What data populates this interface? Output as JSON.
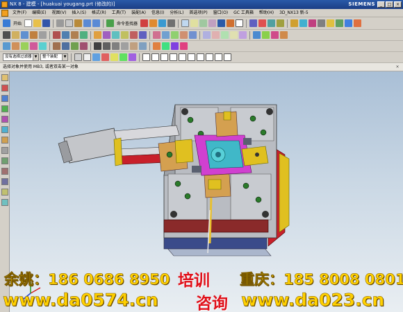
{
  "window": {
    "title": "NX 8 - 建模 - [huakuai yougang.prt (修改的)]",
    "brand": "SIEMENS",
    "controls": [
      "_",
      "□",
      "×"
    ]
  },
  "menu": {
    "items": [
      "文件(F)",
      "编辑(E)",
      "视图(V)",
      "插入(S)",
      "格式(R)",
      "工具(T)",
      "装配(A)",
      "信息(I)",
      "分析(L)",
      "首选项(P)",
      "窗口(O)",
      "GC 工具箱",
      "帮助(H)",
      "3D_NX13 新-5"
    ]
  },
  "toolbar": {
    "start_label": "开始",
    "command_finder_label": "命令查找器",
    "filter_label": "没有选择过滤器",
    "assembly_scope_label": "整个装配"
  },
  "cue": {
    "text": "选择对象并使用 MB3, 或者双击某一对象"
  },
  "watermark": {
    "left_phone": "余姚：186 0686 8950",
    "training": "培训",
    "right_phone": "重庆：185 8008 0801",
    "left_url": "www.da0574.cn",
    "consult": "咨询",
    "right_url": "www.da023.cn"
  },
  "colors": {
    "titlebar": "#1b3e86",
    "viewport_top": "#a9bfd6",
    "viewport_bottom": "#e9eef2",
    "watermark_yellow": "#ffd000",
    "watermark_red": "#e0101a"
  },
  "icons": [
    "start-icon",
    "new-icon",
    "open-icon",
    "save-icon",
    "undo-icon",
    "redo-icon",
    "sketch-icon",
    "extrude-icon",
    "revolve-icon",
    "hole-icon",
    "boolean-icon",
    "view-icon",
    "render-icon",
    "snap-icon",
    "layer-icon",
    "mold-wizard-icon"
  ]
}
